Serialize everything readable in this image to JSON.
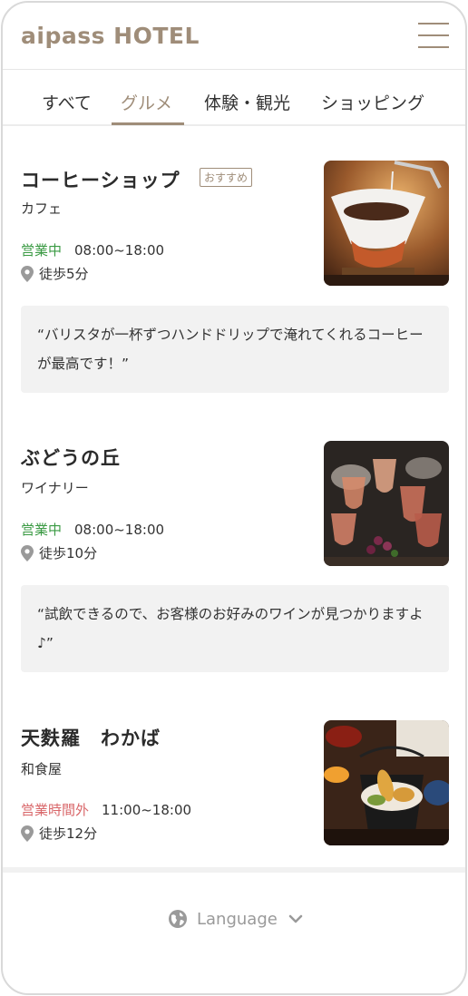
{
  "header": {
    "logo": "aipass HOTEL",
    "menu_icon": "hamburger-menu-icon",
    "accent_color": "#9f8d79"
  },
  "tabs": [
    {
      "label": "すべて",
      "active": false
    },
    {
      "label": "グルメ",
      "active": true
    },
    {
      "label": "体験・観光",
      "active": false
    },
    {
      "label": "ショッピング",
      "active": false
    }
  ],
  "shops": [
    {
      "name": "コーヒーショップ",
      "badge": "おすすめ",
      "category": "カフェ",
      "status": "営業中",
      "status_color": "#3a9a43",
      "hours": "08:00~18:00",
      "walk": "徒歩5分",
      "quote": "“バリスタが一杯ずつハンドドリップで淹れてくれるコーヒーが最高です！”"
    },
    {
      "name": "ぶどうの丘",
      "category": "ワイナリー",
      "status": "営業中",
      "status_color": "#3a9a43",
      "hours": "08:00~18:00",
      "walk": "徒歩10分",
      "quote": "“試飲できるので、お客様のお好みのワインが見つかりますよ♪”"
    },
    {
      "name": "天麩羅　わかば",
      "category": "和食屋",
      "status": "営業時間外",
      "status_color": "#d9676a",
      "hours": "11:00~18:00",
      "walk": "徒歩12分"
    }
  ],
  "footer": {
    "language_label": "Language",
    "globe_icon": "globe-icon",
    "chevron_icon": "chevron-down-icon"
  }
}
